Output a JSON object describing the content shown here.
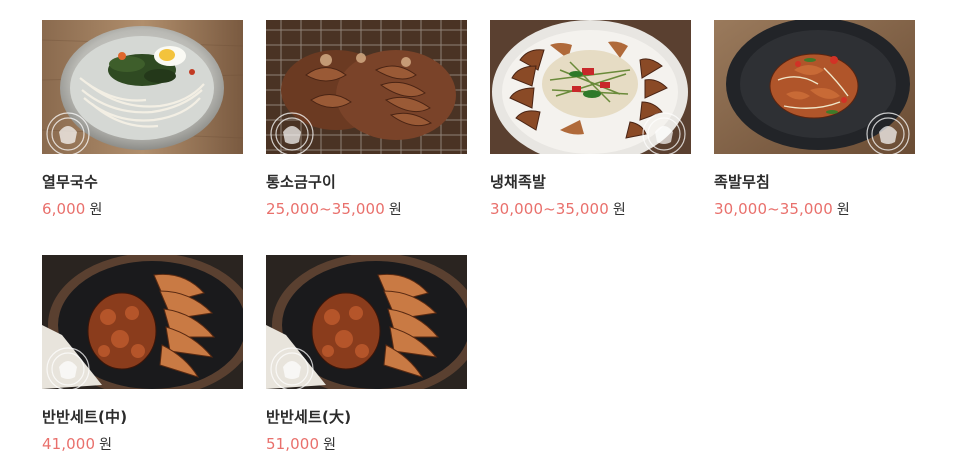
{
  "menu": {
    "items": [
      {
        "name": "열무국수",
        "price": "6,000",
        "unit": "원",
        "image_icon": "cold-noodle-bowl-photo",
        "watermark": "Morning barbecue pork"
      },
      {
        "name": "통소금구이",
        "price": "25,000~35,000",
        "unit": "원",
        "image_icon": "grilled-pork-hock-photo",
        "watermark": "Morning barbecue pork"
      },
      {
        "name": "냉채족발",
        "price": "30,000~35,000",
        "unit": "원",
        "image_icon": "cold-jokbal-salad-photo",
        "watermark": "Morning barbecue pork"
      },
      {
        "name": "족발무침",
        "price": "30,000~35,000",
        "unit": "원",
        "image_icon": "seasoned-jokbal-photo",
        "watermark": "Morning barbecue pork"
      },
      {
        "name": "반반세트(中)",
        "price": "41,000",
        "unit": "원",
        "image_icon": "half-half-set-photo",
        "watermark": "Morning barbecue pork"
      },
      {
        "name": "반반세트(大)",
        "price": "51,000",
        "unit": "원",
        "image_icon": "half-half-set-photo",
        "watermark": "Morning barbecue pork"
      }
    ]
  },
  "colors": {
    "price": "#e9706c",
    "name": "#2b2b2b",
    "unit": "#333333",
    "background": "#ffffff"
  }
}
